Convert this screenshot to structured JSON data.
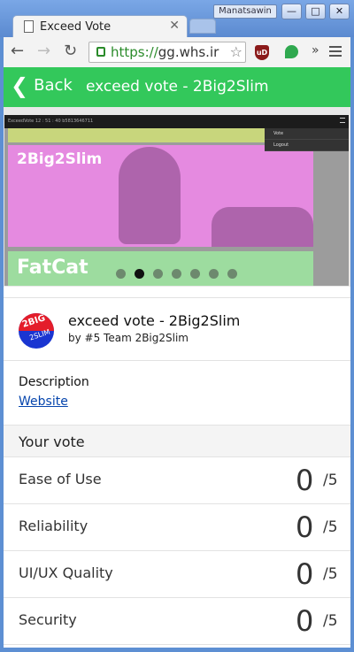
{
  "browser": {
    "tab_title": "Exceed Vote",
    "tab_close": "✕",
    "profile_name": "Manatsawin",
    "url_scheme": "https://",
    "url_rest": "gg.whs.ir",
    "window_buttons": {
      "minimize": "—",
      "maximize": "□",
      "close": "✕"
    },
    "nav": {
      "back": "←",
      "forward": "→",
      "reload": "↻",
      "bookmark": "☆",
      "more_extensions": "»"
    },
    "ext_ublock_label": "uD"
  },
  "appbar": {
    "back_chevron": "❮",
    "back_label": "Back",
    "title": "exceed vote - 2Big2Slim"
  },
  "carousel": {
    "screenshot_bar_text": "ExceedVote     12 : 51 : 40     b5813646711",
    "dropdown_items": [
      "Vote",
      "Logout"
    ],
    "bands": [
      {
        "label": "2Big2Slim",
        "color": "#e58ae0"
      },
      {
        "label": "FatCat",
        "color": "#9ddc9f"
      }
    ],
    "top_band_color": "#c8d67c",
    "dot_count": 7,
    "active_dot": 1
  },
  "team": {
    "logo_text_top": "2BIG",
    "logo_text_bottom": "2SLIM",
    "title": "exceed vote - 2Big2Slim",
    "byline": "by #5 Team 2Big2Slim"
  },
  "description": {
    "label": "Description",
    "link_text": "Website"
  },
  "vote": {
    "header": "Your vote",
    "max_label": "/5",
    "criteria": [
      {
        "label": "Ease of Use",
        "score": "0"
      },
      {
        "label": "Reliability",
        "score": "0"
      },
      {
        "label": "UI/UX Quality",
        "score": "0"
      },
      {
        "label": "Security",
        "score": "0"
      }
    ]
  },
  "colors": {
    "accent_green": "#33c85b",
    "link_blue": "#0645ad",
    "window_frame": "#5d8fd3"
  }
}
